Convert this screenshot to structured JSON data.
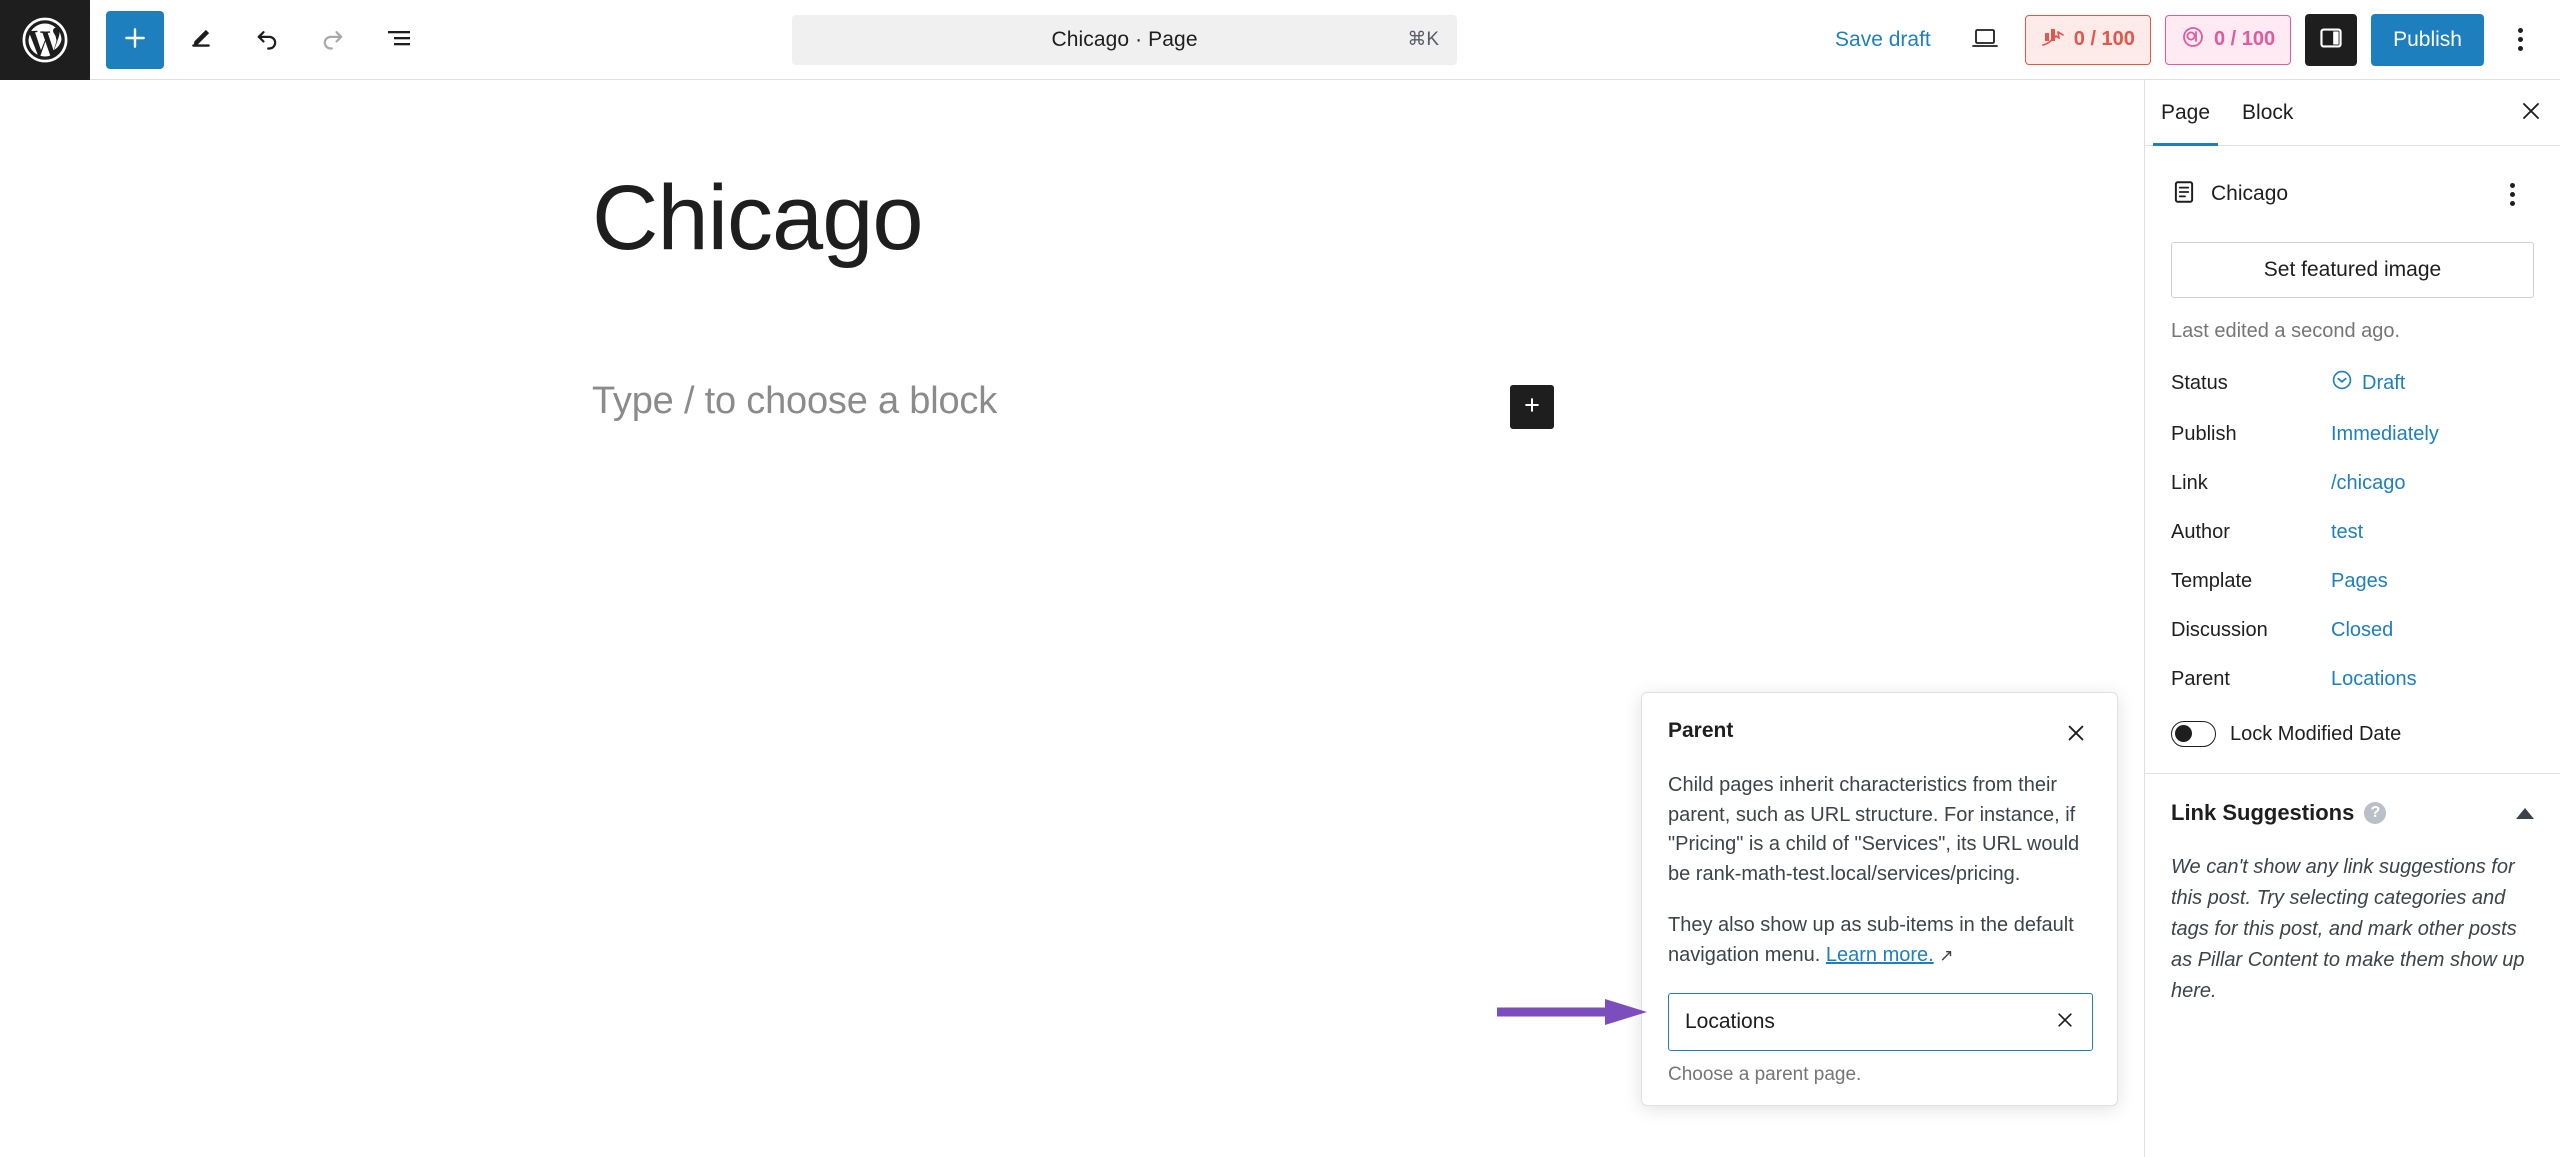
{
  "topbar": {
    "logo_icon": "wordpress-logo-icon",
    "tools": [
      {
        "name": "block-inserter-button",
        "icon": "plus-icon"
      },
      {
        "name": "tools-edit-button",
        "icon": "pencil-icon"
      },
      {
        "name": "undo-button",
        "icon": "undo-arrow-icon"
      },
      {
        "name": "redo-button",
        "icon": "redo-arrow-icon"
      },
      {
        "name": "document-overview-button",
        "icon": "list-view-icon"
      }
    ],
    "document_chip": {
      "title": "Chicago · Page",
      "shortcut": "⌘K"
    },
    "save_draft_label": "Save draft",
    "view_icon": "desktop-preview-icon",
    "seo_score": {
      "label": "0 / 100",
      "icon": "rank-math-seo-icon",
      "color": "#e2574c",
      "background": "#fdebea"
    },
    "ai_score": {
      "label": "0 / 100",
      "icon": "content-ai-icon",
      "color": "#e05a9c",
      "background": "#fdeaf3"
    },
    "sidebar_toggle_icon": "settings-sidebar-icon",
    "publish_label": "Publish",
    "options_icon": "kebab-menu-icon"
  },
  "editor": {
    "post_title": "Chicago",
    "block_placeholder": "Type / to choose a block",
    "inserter_icon": "plus-icon"
  },
  "popover": {
    "title": "Parent",
    "close_icon": "close-x-icon",
    "paragraph1": "Child pages inherit characteristics from their parent, such as URL structure. For instance, if \"Pricing\" is a child of \"Services\", its URL would be rank-math-test.local/services/pricing.",
    "paragraph2_prefix": "They also show up as sub-items in the default navigation menu.",
    "learn_more_label": "Learn more.",
    "learn_more_icon": "external-link-arrow-icon",
    "combobox": {
      "value": "Locations",
      "clear_icon": "close-x-icon",
      "help_text": "Choose a parent page."
    }
  },
  "annotation": {
    "arrow_color": "#7b4dbd",
    "name": "purple-pointer-arrow"
  },
  "sidebar": {
    "tabs": [
      {
        "label": "Page",
        "active": true
      },
      {
        "label": "Block",
        "active": false
      }
    ],
    "close_icon": "close-x-icon",
    "document": {
      "icon": "page-document-icon",
      "name": "Chicago",
      "actions_icon": "kebab-menu-icon"
    },
    "featured_image_button": "Set featured image",
    "last_edited": "Last edited a second ago.",
    "rows": [
      {
        "label": "Status",
        "value": "Draft",
        "icon": "draft-circle-icon"
      },
      {
        "label": "Publish",
        "value": "Immediately",
        "icon": ""
      },
      {
        "label": "Link",
        "value": "/chicago",
        "icon": ""
      },
      {
        "label": "Author",
        "value": "test",
        "icon": ""
      },
      {
        "label": "Template",
        "value": "Pages",
        "icon": ""
      },
      {
        "label": "Discussion",
        "value": "Closed",
        "icon": ""
      },
      {
        "label": "Parent",
        "value": "Locations",
        "icon": ""
      }
    ],
    "lock_modified": {
      "label": "Lock Modified Date",
      "enabled": false
    },
    "link_suggestions": {
      "title": "Link Suggestions",
      "help_icon": "question-mark-icon",
      "collapse_icon": "caret-up-icon",
      "body": "We can't show any link suggestions for this post. Try selecting categories and tags for this post, and mark other posts as Pillar Content to make them show up here."
    }
  }
}
